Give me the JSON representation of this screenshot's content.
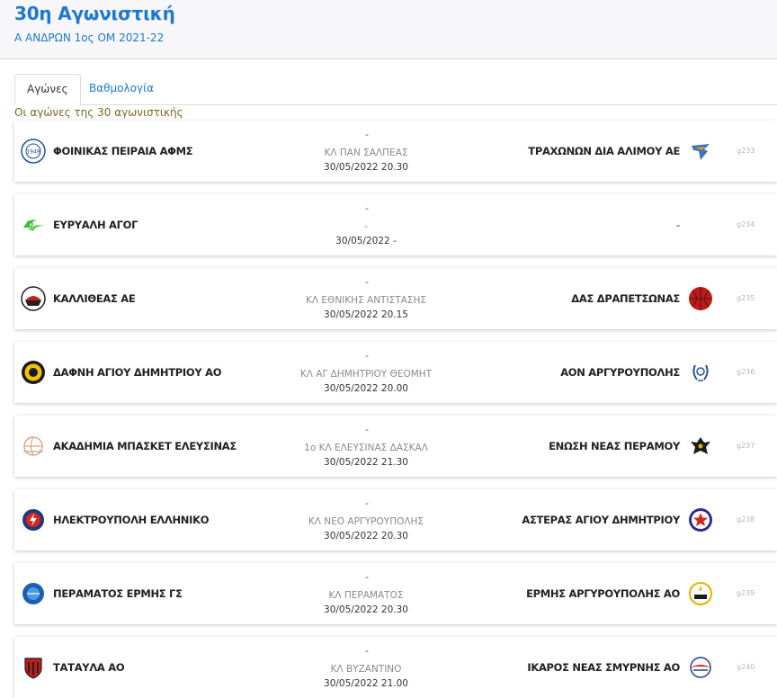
{
  "header": {
    "title": "30η Αγωνιστική",
    "subtitle": "Α ΑΝΔΡΩΝ 1ος ΟΜ 2021-22"
  },
  "tabs": [
    {
      "label": "Αγώνες",
      "active": true
    },
    {
      "label": "Βαθμολογία",
      "active": false
    }
  ],
  "caption": "Οι αγώνες της 30 αγωνιστικής",
  "colors": {
    "accent": "#1e78d2",
    "caption": "#7a6a1e"
  },
  "games": [
    {
      "home": "ΦΟΙΝΙΚΑΣ ΠΕΙΡΑΙΑ ΑΦΜΣ",
      "away": "ΤΡΑΧΩΝΩΝ ΔΙΑ ΑΛΙΜΟΥ ΑΕ",
      "score": "-",
      "venue": "ΚΛ ΠΑΝ ΣΑΛΠΕΑΣ",
      "datetime": "30/05/2022 20.30",
      "code": "g233",
      "home_logo": "phoenix-crest-icon",
      "away_logo": "eagle-crest-icon"
    },
    {
      "home": "ΕΥΡΥΑΛΗ ΑΓΟΓ",
      "away": "-",
      "score": "-",
      "venue": "-",
      "datetime": "30/05/2022 -",
      "code": "g234",
      "home_logo": "green-wave-crest-icon",
      "away_logo": ""
    },
    {
      "home": "ΚΑΛΛΙΘΕΑΣ ΑΕ",
      "away": "ΔΑΣ ΔΡΑΠΕΤΣΩΝΑΣ",
      "score": "-",
      "venue": "ΚΛ ΕΘΝΙΚΗΣ ΑΝΤΙΣΤΑΣΗΣ",
      "datetime": "30/05/2022 20.15",
      "code": "g235",
      "home_logo": "kallithea-crest-icon",
      "away_logo": "red-ball-crest-icon"
    },
    {
      "home": "ΔΑΦΝΗ ΑΓΙΟΥ ΔΗΜΗΤΡΙΟΥ ΑΟ",
      "away": "ΑΟΝ ΑΡΓΥΡΟΥΠΟΛΗΣ",
      "score": "-",
      "venue": "ΚΛ ΑΓ ΔΗΜΗΤΡΙΟΥ ΘΕΟΜΗΤ",
      "datetime": "30/05/2022 20.00",
      "code": "g236",
      "home_logo": "yellow-black-crest-icon",
      "away_logo": "laurel-crest-icon"
    },
    {
      "home": "ΑΚΑΔΗΜΙΑ ΜΠΑΣΚΕΤ ΕΛΕΥΣΙΝΑΣ",
      "away": "ΕΝΩΣΗ ΝΕΑΣ ΠΕΡΑΜΟΥ",
      "score": "-",
      "venue": "1ο ΚΛ ΕΛΕΥΣΙΝΑΣ ΔΑΣΚΑΛ",
      "datetime": "30/05/2022 21.30",
      "code": "g237",
      "home_logo": "basketball-crest-icon",
      "away_logo": "double-eagle-crest-icon"
    },
    {
      "home": "ΗΛΕΚΤΡΟΥΠΟΛΗ ΕΛΛΗΝΙΚΟ",
      "away": "ΑΣΤΕΡΑΣ ΑΓΙΟΥ ΔΗΜΗΤΡΙΟΥ",
      "score": "-",
      "venue": "ΚΛ ΝΕΟ ΑΡΓΥΡΟΥΠΟΛΗΣ",
      "datetime": "30/05/2022 20.30",
      "code": "g238",
      "home_logo": "lightning-crest-icon",
      "away_logo": "star-crest-icon"
    },
    {
      "home": "ΠΕΡΑΜΑΤΟΣ ΕΡΜΗΣ ΓΣ",
      "away": "ΕΡΜΗΣ ΑΡΓΥΡΟΥΠΟΛΗΣ ΑΟ",
      "score": "-",
      "venue": "ΚΛ ΠΕΡΑΜΑΤΟΣ",
      "datetime": "30/05/2022 20.30",
      "code": "g239",
      "home_logo": "blue-ball-crest-icon",
      "away_logo": "hermes-crest-icon"
    },
    {
      "home": "ΤΑΤΑΥΛΑ ΑΟ",
      "away": "ΙΚΑΡΟΣ ΝΕΑΣ ΣΜΥΡΝΗΣ ΑΟ",
      "score": "-",
      "venue": "ΚΛ ΒΥΖΑΝΤΙΝΟ",
      "datetime": "30/05/2022 21.00",
      "code": "g240",
      "home_logo": "shield-crest-icon",
      "away_logo": "ikaros-crest-icon"
    }
  ]
}
